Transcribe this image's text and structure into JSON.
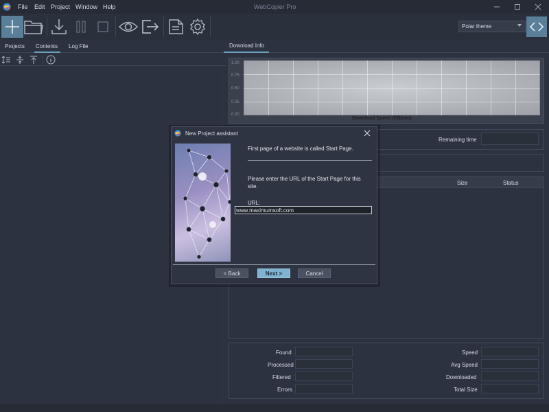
{
  "app": {
    "title": "WebCopier Pro"
  },
  "menu": [
    "File",
    "Edit",
    "Project",
    "Window",
    "Help"
  ],
  "toolbar": {
    "buttons": [
      "add-icon",
      "open-folder-icon",
      "download-icon",
      "pause-icon",
      "stop-icon",
      "view-icon",
      "export-icon",
      "report-icon",
      "gear-icon"
    ],
    "theme": "Polar theme"
  },
  "left_tabs": [
    "Projects",
    "Contents",
    "Log File"
  ],
  "right_tab": "Download Info",
  "graph": {
    "ytick_labels": [
      "1.00",
      "0.75",
      "0.50",
      "0.25",
      "0.00"
    ],
    "xlabel": "Download Speed (KB/sec)"
  },
  "info": {
    "remaining_time_label": "Remaining time",
    "columns": [
      "Size",
      "Status"
    ]
  },
  "stats": {
    "left": [
      "Found",
      "Processed",
      "Filtered",
      "Errors"
    ],
    "right": [
      "Speed",
      "Avg Speed",
      "Downloaded",
      "Total Size"
    ]
  },
  "dialog": {
    "title": "New Project assistant",
    "intro": "First page of a website is called Start Page.",
    "instruction": "Please enter the URL of the Start Page for this site.",
    "url_label": "URL:",
    "url_value": "www.maximumsoft.com",
    "buttons": {
      "back": "< Back",
      "next": "Next >",
      "cancel": "Cancel"
    }
  },
  "colors": {
    "accent": "#6d9ebc",
    "next_button": "#7fb3cf"
  }
}
